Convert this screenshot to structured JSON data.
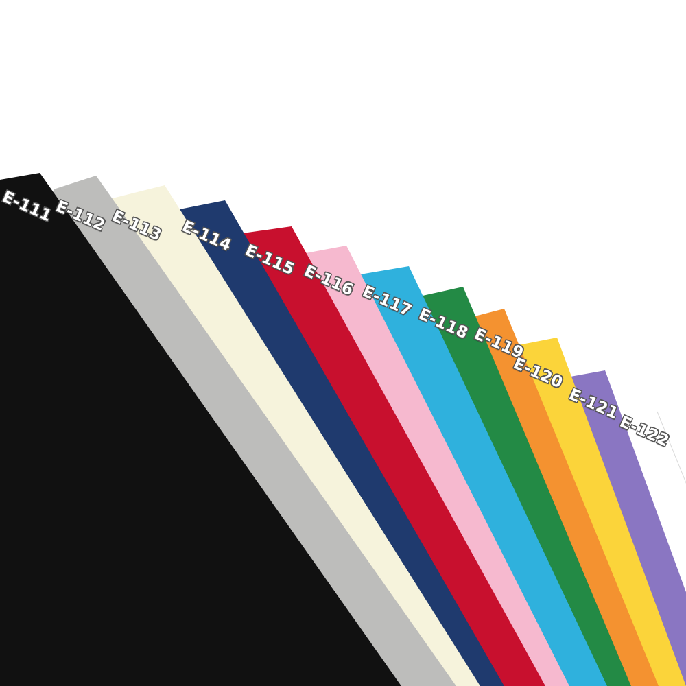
{
  "sheets": [
    {
      "code": "E-111",
      "color": "#111111"
    },
    {
      "code": "E-112",
      "color": "#bdbdbb"
    },
    {
      "code": "E-113",
      "color": "#f6f3dc"
    },
    {
      "code": "E-114",
      "color": "#1f3a6e"
    },
    {
      "code": "E-115",
      "color": "#c8102e"
    },
    {
      "code": "E-116",
      "color": "#f6b9cf"
    },
    {
      "code": "E-117",
      "color": "#2fb1dd"
    },
    {
      "code": "E-118",
      "color": "#238a45"
    },
    {
      "code": "E-119",
      "color": "#f49230"
    },
    {
      "code": "E-120",
      "color": "#fbd43a"
    },
    {
      "code": "E-121",
      "color": "#8a76c2"
    },
    {
      "code": "E-122",
      "color": "#ffffff"
    }
  ]
}
